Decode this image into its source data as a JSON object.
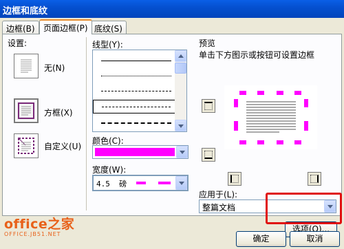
{
  "window": {
    "title": "边框和底纹"
  },
  "tabs": [
    {
      "label": "边框(B)"
    },
    {
      "label": "页面边框(P)"
    },
    {
      "label": "底纹(S)"
    }
  ],
  "setting": {
    "heading": "设置:",
    "options": [
      {
        "label": "无(N)"
      },
      {
        "label": "方框(X)"
      },
      {
        "label": "自定义(U)"
      }
    ]
  },
  "style": {
    "heading": "线型(Y):"
  },
  "color": {
    "heading": "颜色(C):",
    "value_color": "#ff00ff"
  },
  "width": {
    "heading": "宽度(W):",
    "value": "4.5  磅"
  },
  "preview": {
    "heading": "预览",
    "hint": "单击下方图示或按钮可设置边框",
    "accent": "#ff00ff"
  },
  "apply_to": {
    "heading": "应用于(L):",
    "value": "整篇文档"
  },
  "options_button": {
    "label": "选项(O)..."
  },
  "ok_button": {
    "label": "确定"
  },
  "cancel_button": {
    "label": "取消"
  },
  "watermark": {
    "main": "office之家",
    "sub": "OFFICE.JB51.NET"
  }
}
